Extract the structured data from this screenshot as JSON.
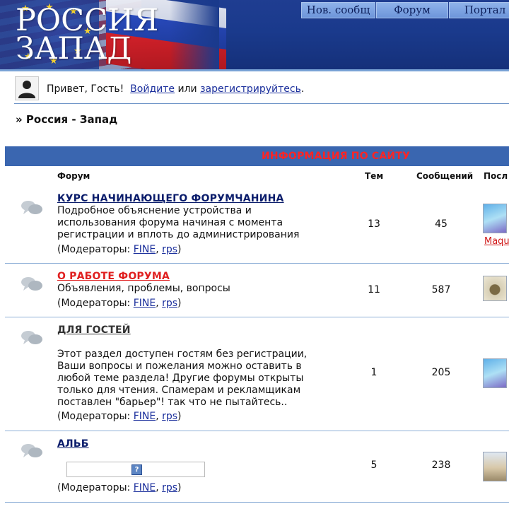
{
  "header": {
    "logo_line1": "РОССИЯ",
    "logo_line2": "ЗАПАД",
    "nav": [
      {
        "label": "Нов. сообщ"
      },
      {
        "label": "Форум"
      },
      {
        "label": "Портал"
      }
    ]
  },
  "greeting": {
    "hello": "Привет, Гость!",
    "login_link": "Войдите",
    "or": "или",
    "register_link": "зарегистрируйтесь",
    "end": "."
  },
  "breadcrumb": "» Россия - Запад",
  "category": {
    "title": "ИНФОРМАЦИЯ ПО САЙТУ",
    "columns": {
      "forum": "Форум",
      "topics": "Тем",
      "posts": "Сообщений",
      "last": "Посл"
    }
  },
  "forums": [
    {
      "title": "КУРС НАЧИНАЮЩЕГО ФОРУМЧАНИНА",
      "desc": "Подробное объяснение устройства и использования форума начиная с момента регистрации и вплоть до администрирования",
      "mods_label": "(Модераторы:",
      "mods": [
        "FINE",
        "rps"
      ],
      "topics": "13",
      "posts": "45",
      "last_user": "Maqu"
    },
    {
      "title": "О РАБОТЕ ФОРУМА",
      "desc": "Объявления, проблемы, вопросы",
      "mods_label": "(Модераторы:",
      "mods": [
        "FINE",
        "rps"
      ],
      "topics": "11",
      "posts": "587"
    },
    {
      "title": "ДЛЯ ГОСТЕЙ",
      "desc": "Этот раздел доступен гостям без регистрации, Ваши вопросы и пожелания можно оставить в любой теме раздела! Другие форумы открыты только для чтения. Спамерам и рекламщикам поставлен \"барьер\"! так что не пытайтесь..",
      "mods_label": "(Модераторы:",
      "mods": [
        "FINE",
        "rps"
      ],
      "topics": "1",
      "posts": "205"
    },
    {
      "title": "АЛЬБ",
      "mods_label": "(Модераторы:",
      "mods": [
        "FINE",
        "rps"
      ],
      "topics": "5",
      "posts": "238"
    }
  ],
  "sep": ",",
  "close": ")"
}
